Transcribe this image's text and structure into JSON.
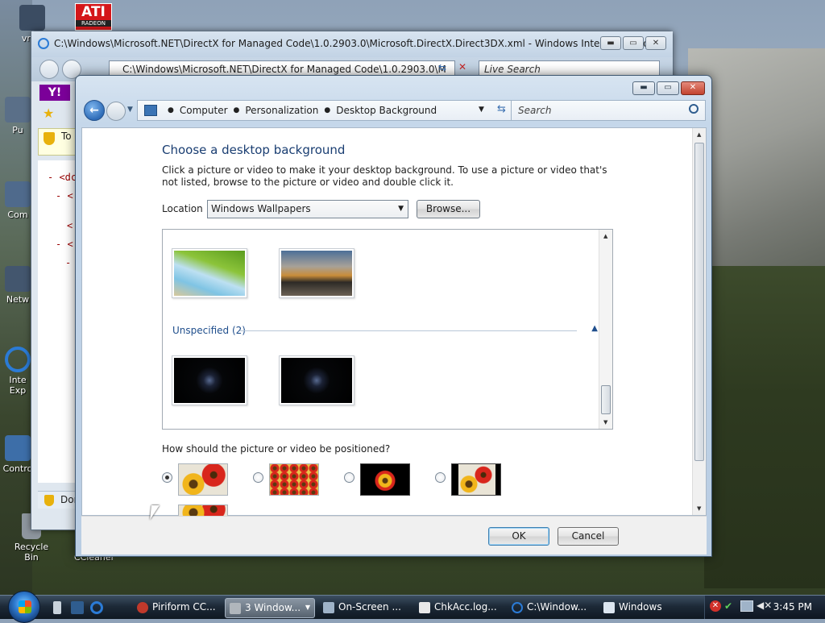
{
  "desktop": {
    "icons": [
      {
        "label": "vmw",
        "color": "#3b4c62"
      },
      {
        "label": "Pu",
        "color": "#5a6f88"
      },
      {
        "label": "Com",
        "color": "#4f6a8c"
      },
      {
        "label": "Netw",
        "color": "#43566e"
      },
      {
        "label": "Inte Exp",
        "color": "#2b7bd6"
      },
      {
        "label": "Contro",
        "color": "#3d6ea8"
      },
      {
        "label": "Recycle Bin",
        "color": "#8e969e"
      }
    ],
    "ati_logo": {
      "top": "ATI",
      "bottom": "RADEON",
      "color": "#d4161a"
    },
    "behind_label": "CCleaner"
  },
  "ie_window": {
    "title": "C:\\Windows\\Microsoft.NET\\DirectX for Managed Code\\1.0.2903.0\\Microsoft.DirectX.Direct3DX.xml - Windows Internet Explor...",
    "address": "C:\\Windows\\Microsoft.NET\\DirectX for Managed Code\\1.0.2903.0\\M",
    "search_placeholder": "Live Search",
    "infobar_text": "To h com",
    "content_lines": [
      "- <dc",
      "- <",
      "<",
      "- <",
      "-",
      "-",
      "-"
    ],
    "status": "Done",
    "yahoo": "Y!"
  },
  "dialog": {
    "breadcrumb": [
      "Computer",
      "Personalization",
      "Desktop Background"
    ],
    "search_placeholder": "Search",
    "heading": "Choose a desktop background",
    "instructions": "Click a picture or video to make it your desktop background. To use a picture or video that's not listed, browse to the picture or video and double click it.",
    "location_label": "Location",
    "location_value": "Windows Wallpapers",
    "browse_label": "Browse...",
    "group_label": "Unspecified (2)",
    "position_question": "How should the picture or video be positioned?",
    "position_options": [
      {
        "name": "fill",
        "selected": true
      },
      {
        "name": "tile",
        "selected": false
      },
      {
        "name": "center",
        "selected": false
      },
      {
        "name": "fit",
        "selected": false
      }
    ],
    "ok_label": "OK",
    "cancel_label": "Cancel"
  },
  "taskbar": {
    "items": [
      {
        "label": "Piriform CC...",
        "icon_color": "#c0392b",
        "active": false
      },
      {
        "label": "3 Window...",
        "icon_color": "#b0b6bc",
        "active": true
      },
      {
        "label": "On-Screen ...",
        "icon_color": "#9fb3c8",
        "active": false
      },
      {
        "label": "ChkAcc.log...",
        "icon_color": "#e8e8e8",
        "active": false
      },
      {
        "label": "C:\\Window...",
        "icon_color": "#2b7bd6",
        "active": false
      },
      {
        "label": "Windows",
        "icon_color": "#dce6f0",
        "active": false
      }
    ],
    "clock": "3:45 PM"
  }
}
